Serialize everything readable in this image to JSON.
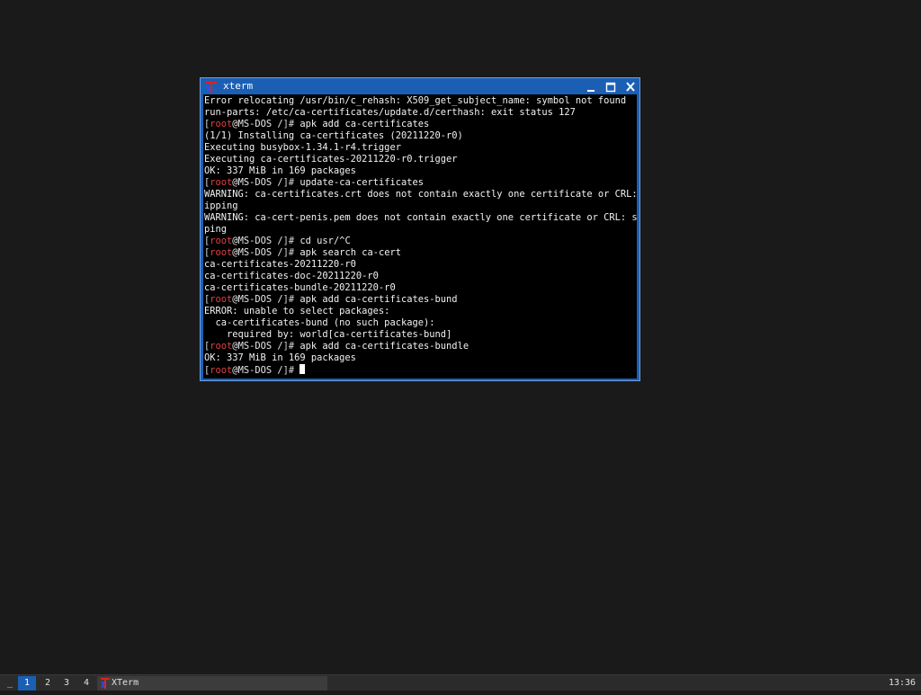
{
  "window": {
    "title": "xterm",
    "icons": {
      "app": "xterm-icon",
      "minimize": "minimize-icon",
      "maximize": "maximize-icon",
      "close": "close-icon"
    }
  },
  "colors": {
    "titlebar": "#1b5fb5",
    "terminal_bg": "#000000",
    "terminal_fg": "#f2f2f2",
    "prompt_user": "#e04040",
    "desktop_bg": "#1a1a1a",
    "taskbar_active": "#1b5fb5"
  },
  "prompt": {
    "open": "[",
    "user": "root",
    "at": "@",
    "host": "MS-DOS",
    "path": " /",
    "close": "]# "
  },
  "terminal": {
    "lines": [
      {
        "type": "output",
        "text": "Error relocating /usr/bin/c_rehash: X509_get_subject_name: symbol not found"
      },
      {
        "type": "output",
        "text": "run-parts: /etc/ca-certificates/update.d/certhash: exit status 127"
      },
      {
        "type": "command",
        "text": "apk add ca-certificates"
      },
      {
        "type": "output",
        "text": "(1/1) Installing ca-certificates (20211220-r0)"
      },
      {
        "type": "output",
        "text": "Executing busybox-1.34.1-r4.trigger"
      },
      {
        "type": "output",
        "text": "Executing ca-certificates-20211220-r0.trigger"
      },
      {
        "type": "output",
        "text": "OK: 337 MiB in 169 packages"
      },
      {
        "type": "command",
        "text": "update-ca-certificates"
      },
      {
        "type": "output",
        "text": "WARNING: ca-certificates.crt does not contain exactly one certificate or CRL: sk"
      },
      {
        "type": "output",
        "text": "ipping"
      },
      {
        "type": "output",
        "text": "WARNING: ca-cert-penis.pem does not contain exactly one certificate or CRL: skip"
      },
      {
        "type": "output",
        "text": "ping"
      },
      {
        "type": "command",
        "text": "cd usr/^C"
      },
      {
        "type": "command",
        "text": "apk search ca-cert"
      },
      {
        "type": "output",
        "text": "ca-certificates-20211220-r0"
      },
      {
        "type": "output",
        "text": "ca-certificates-doc-20211220-r0"
      },
      {
        "type": "output",
        "text": "ca-certificates-bundle-20211220-r0"
      },
      {
        "type": "command",
        "text": "apk add ca-certificates-bund"
      },
      {
        "type": "output",
        "text": "ERROR: unable to select packages:"
      },
      {
        "type": "output",
        "text": "  ca-certificates-bund (no such package):"
      },
      {
        "type": "output",
        "text": "    required by: world[ca-certificates-bund]"
      },
      {
        "type": "command",
        "text": "apk add ca-certificates-bundle"
      },
      {
        "type": "output",
        "text": "OK: 337 MiB in 169 packages"
      },
      {
        "type": "prompt",
        "text": ""
      }
    ]
  },
  "taskbar": {
    "show_desktop_label": "_",
    "desktops": [
      "1",
      "2",
      "3",
      "4"
    ],
    "active_desktop": "1",
    "task_label": "XTerm",
    "task_icon": "xterm-icon",
    "clock": "13:36"
  }
}
